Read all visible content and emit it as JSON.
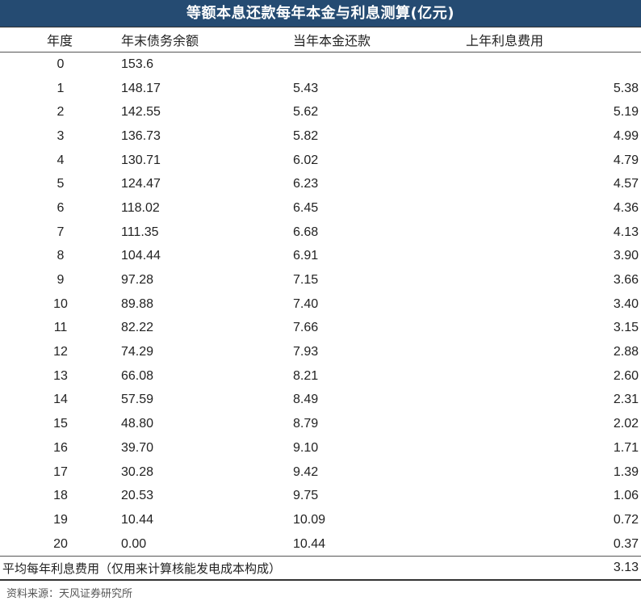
{
  "title": "等额本息还款每年本金与利息测算(亿元)",
  "chart_data": {
    "type": "table",
    "columns": [
      "年度",
      "年末债务余额",
      "当年本金还款",
      "上年利息费用"
    ],
    "rows": [
      [
        "0",
        "153.6",
        "",
        ""
      ],
      [
        "1",
        "148.17",
        "5.43",
        "5.38"
      ],
      [
        "2",
        "142.55",
        "5.62",
        "5.19"
      ],
      [
        "3",
        "136.73",
        "5.82",
        "4.99"
      ],
      [
        "4",
        "130.71",
        "6.02",
        "4.79"
      ],
      [
        "5",
        "124.47",
        "6.23",
        "4.57"
      ],
      [
        "6",
        "118.02",
        "6.45",
        "4.36"
      ],
      [
        "7",
        "111.35",
        "6.68",
        "4.13"
      ],
      [
        "8",
        "104.44",
        "6.91",
        "3.90"
      ],
      [
        "9",
        "97.28",
        "7.15",
        "3.66"
      ],
      [
        "10",
        "89.88",
        "7.40",
        "3.40"
      ],
      [
        "11",
        "82.22",
        "7.66",
        "3.15"
      ],
      [
        "12",
        "74.29",
        "7.93",
        "2.88"
      ],
      [
        "13",
        "66.08",
        "8.21",
        "2.60"
      ],
      [
        "14",
        "57.59",
        "8.49",
        "2.31"
      ],
      [
        "15",
        "48.80",
        "8.79",
        "2.02"
      ],
      [
        "16",
        "39.70",
        "9.10",
        "1.71"
      ],
      [
        "17",
        "30.28",
        "9.42",
        "1.39"
      ],
      [
        "18",
        "20.53",
        "9.75",
        "1.06"
      ],
      [
        "19",
        "10.44",
        "10.09",
        "0.72"
      ],
      [
        "20",
        "0.00",
        "10.44",
        "0.37"
      ]
    ],
    "footer": {
      "label": "平均每年利息费用（仅用来计算核能发电成本构成）",
      "value": "3.13"
    }
  },
  "source": "资料来源：天风证券研究所",
  "colors": {
    "title_bg": "#254b72",
    "title_text": "#ffffff"
  }
}
